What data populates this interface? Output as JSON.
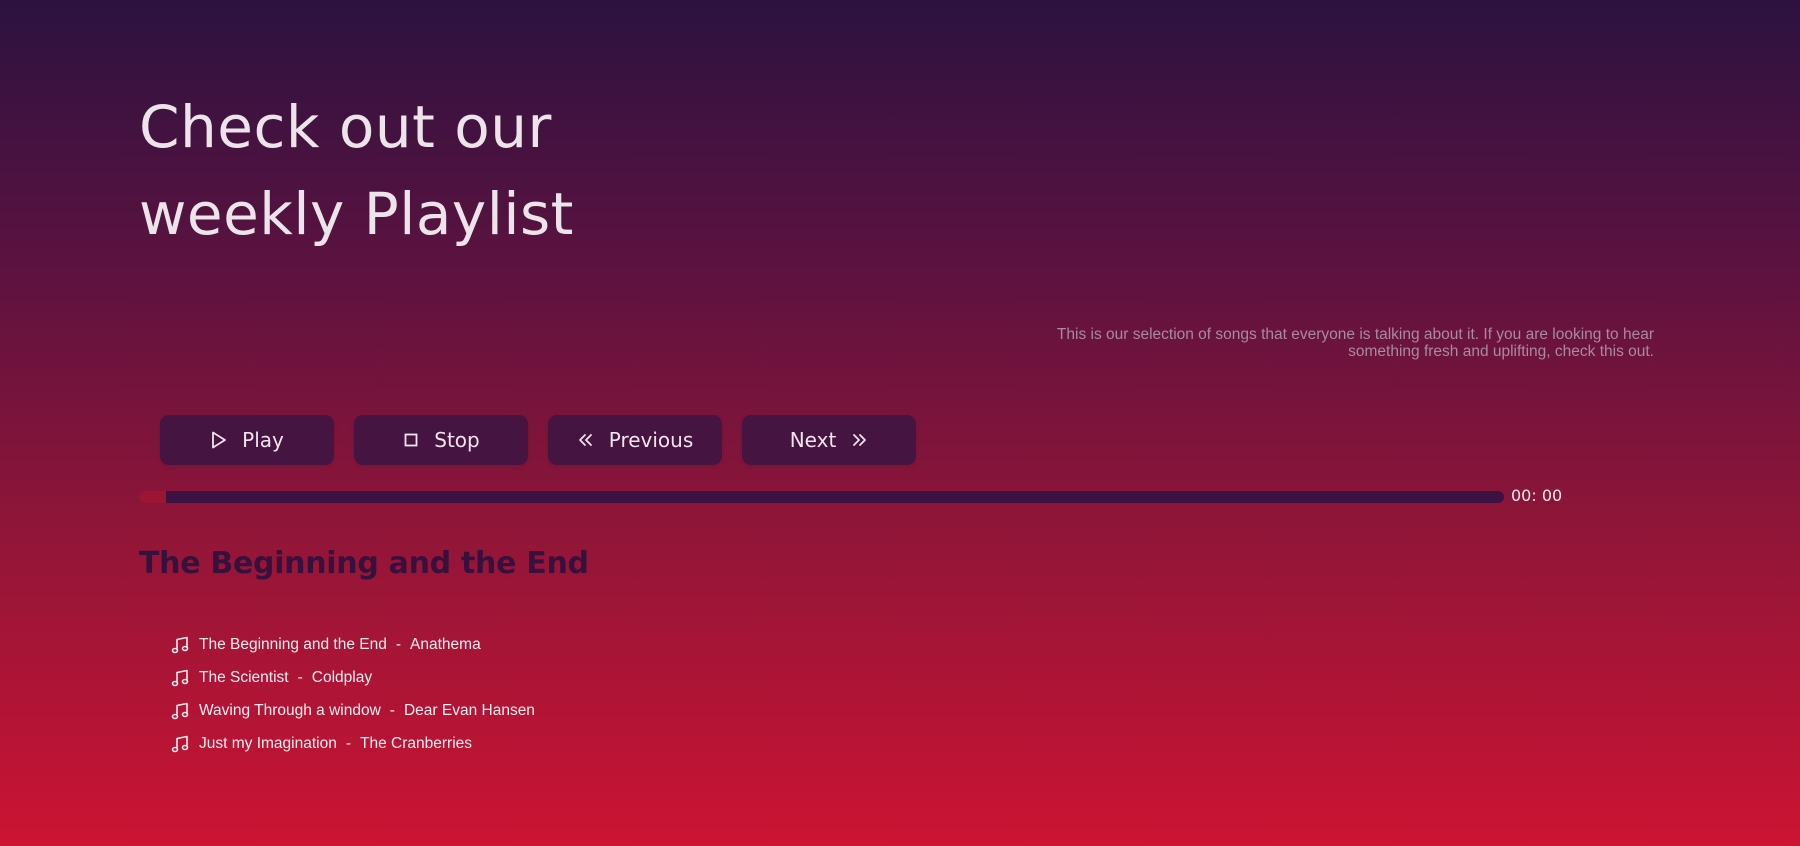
{
  "hero": {
    "title_line1": "Check out our",
    "title_line2": "weekly Playlist"
  },
  "description": "This is our selection of songs that everyone is talking about it. If you are looking to hear something fresh and uplifting, check this out.",
  "controls": {
    "play_label": "Play",
    "stop_label": "Stop",
    "previous_label": "Previous",
    "next_label": "Next"
  },
  "player": {
    "progress_fraction": 0.02,
    "time": "00: 00",
    "now_playing": "The Beginning and the End"
  },
  "playlist": [
    {
      "title": "The Beginning and the End",
      "separator": "-",
      "artist": "Anathema"
    },
    {
      "title": "The Scientist",
      "separator": "-",
      "artist": "Coldplay"
    },
    {
      "title": "Waving Through a window",
      "separator": "-",
      "artist": "Dear Evan Hansen"
    },
    {
      "title": "Just my Imagination",
      "separator": "-",
      "artist": "The Cranberries"
    }
  ],
  "icons": {
    "play": "play-icon",
    "stop": "stop-icon",
    "previous": "double-chevron-left-icon",
    "next": "double-chevron-right-icon",
    "track": "music-note-icon"
  },
  "colors": {
    "background_top": "#2c1240",
    "background_bottom": "#cc1433",
    "button_bg": "#451440",
    "progress_track": "#3b1242",
    "progress_fill": "#9c1634",
    "now_playing_text": "#37113d"
  }
}
